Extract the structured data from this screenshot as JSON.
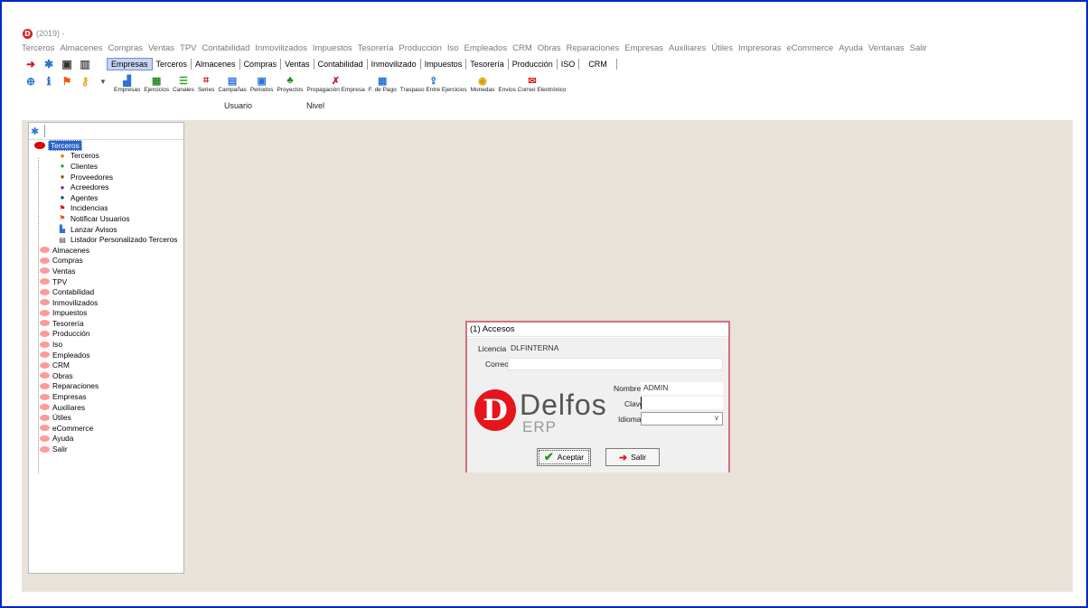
{
  "title": {
    "logo": "D",
    "text": "(2019) -"
  },
  "menu": [
    "Terceros",
    "Almacenes",
    "Compras",
    "Ventas",
    "TPV",
    "Contabilidad",
    "Inmovilizados",
    "Impuestos",
    "Tesorería",
    "Producción",
    "Iso",
    "Empleados",
    "CRM",
    "Obras",
    "Reparaciones",
    "Empresas",
    "Auxiliares",
    "Útiles",
    "Impresoras",
    "eCommerce",
    "Ayuda",
    "Ventanas",
    "Salir"
  ],
  "module_tabs": [
    "Empresas",
    "Terceros",
    "Almacenes",
    "Compras",
    "Ventas",
    "Contabilidad",
    "Inmovilizado",
    "Impuestos",
    "Tesorería",
    "Producción",
    "ISO",
    "CRM"
  ],
  "active_tab": "Empresas",
  "toolbar": [
    "Empresas",
    "Ejercicios",
    "Canales",
    "Series",
    "Campañas",
    "Periodos",
    "Proyectos",
    "Propagación Empresa",
    "F. de Pago",
    "Traspaso Entre Ejercicios",
    "Monedas",
    "Envios Correo Electrónico"
  ],
  "groups": {
    "usuario": "Usuario",
    "nivel": "Nivel"
  },
  "tree": {
    "root": "Terceros",
    "children": [
      "Terceros",
      "Clientes",
      "Proveedores",
      "Acreedores",
      "Agentes",
      "Incidencias",
      "Notificar Usuarios",
      "Lanzar Avisos",
      "Listador Personalizado Terceros"
    ],
    "modules": [
      "Almacenes",
      "Compras",
      "Ventas",
      "TPV",
      "Contabilidad",
      "Inmovilizados",
      "Impuestos",
      "Tesorería",
      "Producción",
      "Iso",
      "Empleados",
      "CRM",
      "Obras",
      "Reparaciones",
      "Empresas",
      "Auxiliares",
      "Útiles",
      "eCommerce",
      "Ayuda",
      "Salir"
    ]
  },
  "dialog": {
    "title": "(1) Accesos",
    "licencia_label": "Licencia",
    "licencia_value": "DLFINTERNA",
    "correo_label": "Correo",
    "correo_value": "",
    "nombre_label": "Nombre",
    "nombre_value": "ADMIN",
    "clave_label": "Clave",
    "idioma_label": "Idioma",
    "idioma_value": "",
    "brand": "Delfos",
    "brand_sub": "ERP",
    "brand_letter": "D",
    "accept": "Aceptar",
    "exit": "Salir"
  },
  "colors": {
    "border": "#0026cc",
    "workspace": "#e8e2d8",
    "dialog_border": "#d1727e",
    "brand_red": "#e5151b",
    "selection": "#2a63c9"
  }
}
